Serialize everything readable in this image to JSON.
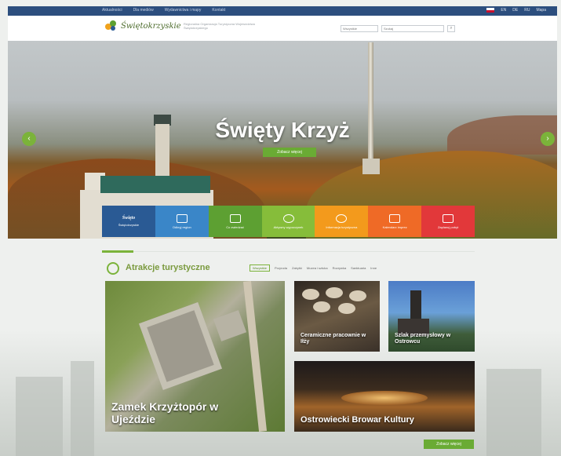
{
  "topbar": {
    "links": [
      "Aktualności",
      "Dla mediów",
      "Wydawnictwa i mapy",
      "Kontakt"
    ],
    "right_items": [
      "EN",
      "DE",
      "RU",
      "Mapa"
    ]
  },
  "header": {
    "logo_text": "Świętokrzyskie",
    "tagline": "Regionalna Organizacja Turystyczna Województwa Świętokrzyskiego",
    "search": {
      "select_value": "Wszystkie",
      "placeholder": "Szukaj",
      "button_symbol": "⌕"
    }
  },
  "hero": {
    "title": "Święty Krzyż",
    "button_label": "Zobacz więcej",
    "arrow_left": "‹",
    "arrow_right": "›"
  },
  "tiles": [
    {
      "label": "Świętokrzyskie",
      "icon": "brand-logo",
      "color": "#2a5a94"
    },
    {
      "label": "Odkryj region",
      "icon": "map-icon",
      "color": "#3a86c8"
    },
    {
      "label": "Co zwiedzać",
      "icon": "museum-icon",
      "color": "#5da032"
    },
    {
      "label": "Aktywny wypoczynek",
      "icon": "bicycle-icon",
      "color": "#86bd3a"
    },
    {
      "label": "Informacja turystyczna",
      "icon": "info-icon",
      "color": "#f39a1c"
    },
    {
      "label": "Kalendarz imprez",
      "icon": "calendar-icon",
      "color": "#ef6a26"
    },
    {
      "label": "Zaplanuj pobyt",
      "icon": "suitcase-icon",
      "color": "#e2383a"
    }
  ],
  "section": {
    "title": "Atrakcje turystyczne",
    "filters": [
      "Wszystkie",
      "Przyroda",
      "Zabytki",
      "Muzea i sztuka",
      "Rozrywka",
      "Sanktuaria",
      "Inne"
    ],
    "cards": {
      "big": "Zamek Krzyżtopór w Ujeździe",
      "small1": "Ceramiczne pracownie w Iłży",
      "small2": "Szlak przemysłowy w Ostrowcu",
      "wide": "Ostrowiecki Browar Kultury"
    },
    "more_label": "Zobacz więcej"
  },
  "colors": {
    "topbar": "#2c4e7e",
    "accent_green": "#7bb33a",
    "button_green": "#6aab34"
  }
}
